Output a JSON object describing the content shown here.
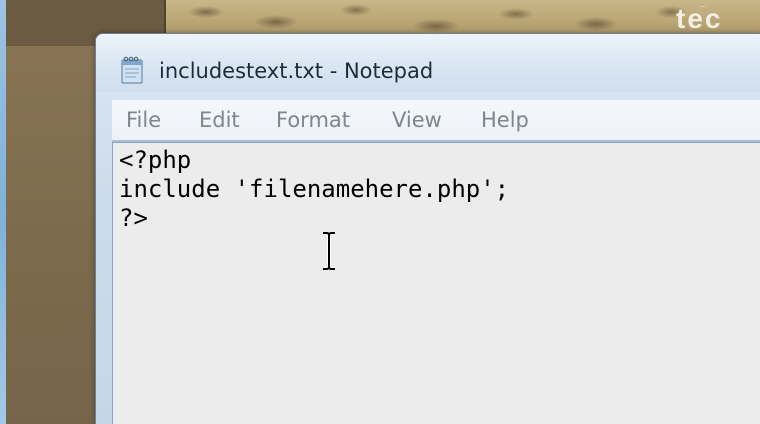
{
  "desktop": {
    "photo_text": "tec",
    "photo_small_text": "..."
  },
  "window": {
    "title": "includestext.txt - Notepad",
    "icon": "notepad-icon"
  },
  "menu": {
    "items": [
      "File",
      "Edit",
      "Format",
      "View",
      "Help"
    ]
  },
  "editor": {
    "lines": [
      "<?php",
      "include 'filenamehere.php';",
      "?>"
    ]
  },
  "cursor": {
    "icon": "text-cursor-icon"
  },
  "colors": {
    "menu_text": "#7d8590",
    "title_text": "#1e2b38",
    "editor_bg": "#ececec",
    "window_frame": "#cddcec",
    "desktop_brown": "#7d6b4f"
  }
}
